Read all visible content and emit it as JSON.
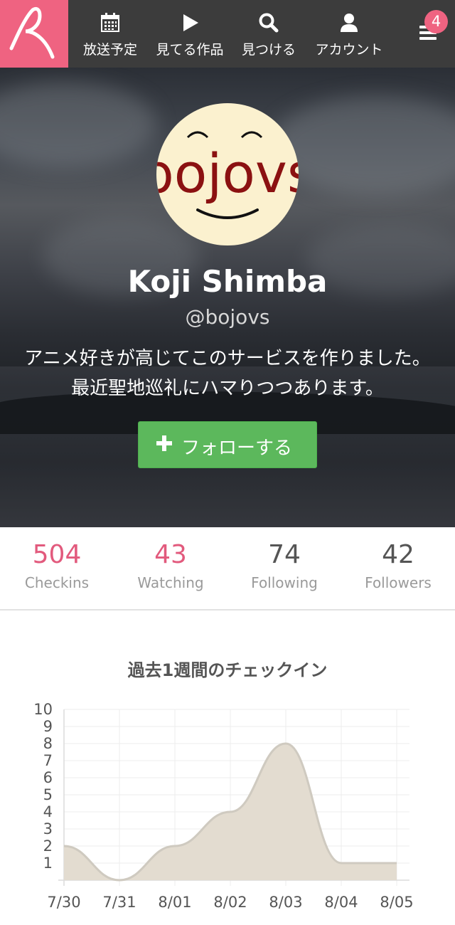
{
  "nav": {
    "items": [
      {
        "label": "放送予定",
        "icon": "calendar-icon"
      },
      {
        "label": "見てる作品",
        "icon": "play-icon"
      },
      {
        "label": "見つける",
        "icon": "search-icon"
      },
      {
        "label": "アカウント",
        "icon": "user-icon"
      }
    ],
    "menu_icon": "hamburger-icon",
    "notification_count": "4"
  },
  "profile": {
    "avatar_text": "bojovs",
    "name": "Koji Shimba",
    "handle": "@bojovs",
    "bio_line1": "アニメ好きが高じてこのサービスを作りました。",
    "bio_line2": "最近聖地巡礼にハマりつつあります。",
    "follow_label": "フォローする"
  },
  "stats": [
    {
      "value": "504",
      "label": "Checkins",
      "color": "#e25a7d"
    },
    {
      "value": "43",
      "label": "Watching",
      "color": "#e25a7d"
    },
    {
      "value": "74",
      "label": "Following",
      "color": "#555555"
    },
    {
      "value": "42",
      "label": "Followers",
      "color": "#555555"
    }
  ],
  "colors": {
    "brand": "#ef6381",
    "follow_button": "#5cb85c",
    "chart_fill": "#e3dcd0",
    "chart_stroke": "#cfcac0"
  },
  "chart_title": "過去1週間のチェックイン",
  "chart_data": {
    "type": "area",
    "title": "過去1週間のチェックイン",
    "categories": [
      "7/30",
      "7/31",
      "8/01",
      "8/02",
      "8/03",
      "8/04",
      "8/05"
    ],
    "values": [
      2,
      0,
      2,
      4,
      8,
      1,
      1
    ],
    "ylim": [
      0,
      10
    ],
    "yticks": [
      1,
      2,
      3,
      4,
      5,
      6,
      7,
      8,
      9,
      10
    ],
    "grid": true,
    "xlabel": "",
    "ylabel": ""
  }
}
